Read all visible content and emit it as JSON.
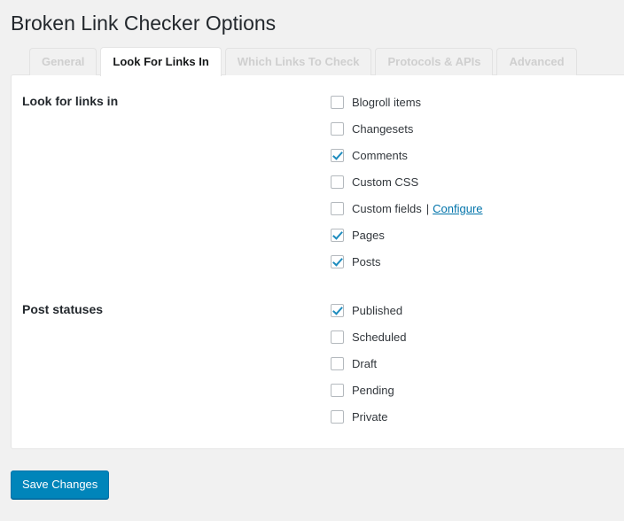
{
  "page": {
    "title": "Broken Link Checker Options"
  },
  "tabs": [
    {
      "label": "General",
      "active": false
    },
    {
      "label": "Look For Links In",
      "active": true
    },
    {
      "label": "Which Links To Check",
      "active": false
    },
    {
      "label": "Protocols & APIs",
      "active": false
    },
    {
      "label": "Advanced",
      "active": false
    }
  ],
  "sections": [
    {
      "heading": "Look for links in",
      "options": [
        {
          "label": "Blogroll items",
          "checked": false
        },
        {
          "label": "Changesets",
          "checked": false
        },
        {
          "label": "Comments",
          "checked": true
        },
        {
          "label": "Custom CSS",
          "checked": false
        },
        {
          "label": "Custom fields",
          "checked": false,
          "separator": "|",
          "link": "Configure"
        },
        {
          "label": "Pages",
          "checked": true
        },
        {
          "label": "Posts",
          "checked": true
        }
      ]
    },
    {
      "heading": "Post statuses",
      "options": [
        {
          "label": "Published",
          "checked": true
        },
        {
          "label": "Scheduled",
          "checked": false
        },
        {
          "label": "Draft",
          "checked": false
        },
        {
          "label": "Pending",
          "checked": false
        },
        {
          "label": "Private",
          "checked": false
        }
      ]
    }
  ],
  "submit": {
    "save_label": "Save Changes"
  },
  "colors": {
    "accent": "#0085ba",
    "link": "#0073aa",
    "checkmark": "#1e8cbe",
    "page_background": "#f1f1f1",
    "panel_background": "#ffffff",
    "title_text": "#23282d",
    "inactive_tab_text": "#cfcfcf"
  }
}
